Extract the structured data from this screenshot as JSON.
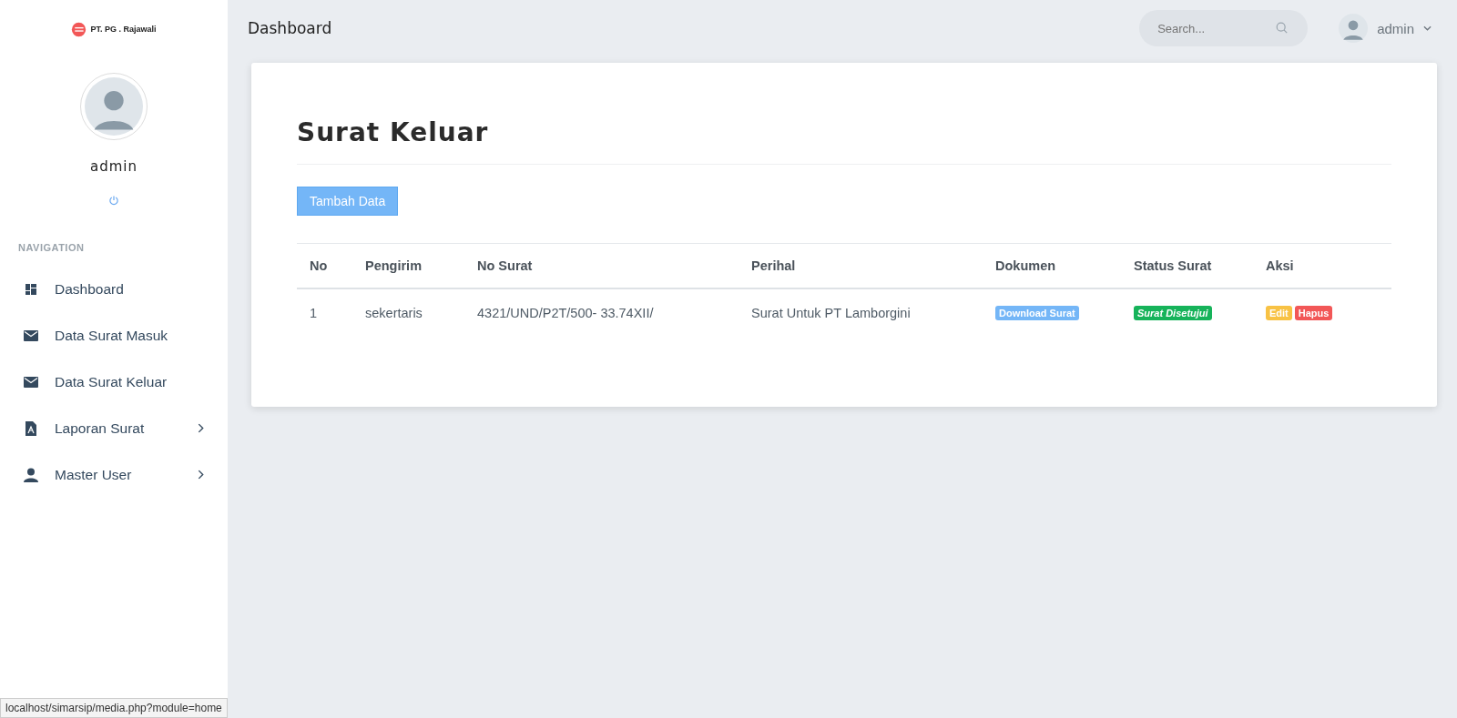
{
  "brand": {
    "name": "PT. PG . Rajawali"
  },
  "profile": {
    "name": "admin"
  },
  "nav_heading": "NAVIGATION",
  "sidebar": {
    "items": [
      {
        "label": "Dashboard",
        "kind": "dashboard",
        "expandable": false
      },
      {
        "label": "Data Surat Masuk",
        "kind": "mail",
        "expandable": false
      },
      {
        "label": "Data Surat Keluar",
        "kind": "mail",
        "expandable": false
      },
      {
        "label": "Laporan Surat",
        "kind": "pdf",
        "expandable": true
      },
      {
        "label": "Master User",
        "kind": "user",
        "expandable": true
      }
    ]
  },
  "topbar": {
    "title": "Dashboard",
    "search": {
      "placeholder": "Search..."
    },
    "user": "admin"
  },
  "page": {
    "title": "Surat Keluar",
    "add_button": "Tambah Data"
  },
  "table": {
    "columns": [
      "No",
      "Pengirim",
      "No Surat",
      "Perihal",
      "Dokumen",
      "Status Surat",
      "Aksi"
    ],
    "rows": [
      {
        "no": "1",
        "pengirim": "sekertaris",
        "no_surat": "4321/UND/P2T/500- 33.74XII/",
        "perihal": "Surat Untuk PT Lamborgini",
        "dokumen": {
          "label": "Download Surat",
          "kind": "info"
        },
        "status": {
          "label": "Surat Disetujui",
          "kind": "success"
        },
        "actions": [
          {
            "label": "Edit",
            "kind": "warning"
          },
          {
            "label": "Hapus",
            "kind": "danger"
          }
        ]
      }
    ]
  },
  "status_url": "localhost/simarsip/media.php?module=home"
}
